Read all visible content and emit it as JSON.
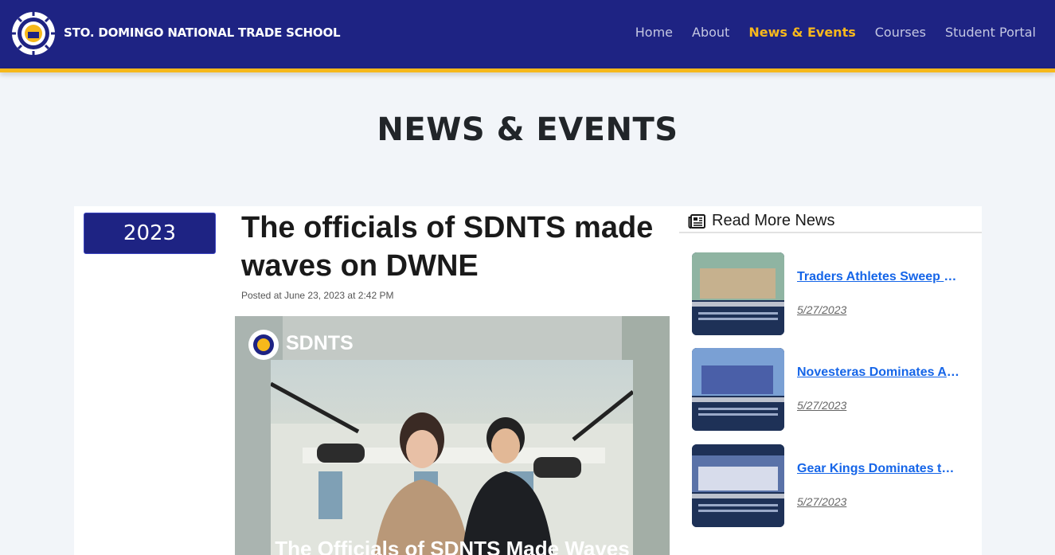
{
  "header": {
    "brand": "STO. DOMINGO NATIONAL TRADE SCHOOL",
    "nav": [
      {
        "label": "Home",
        "active": false
      },
      {
        "label": "About",
        "active": false
      },
      {
        "label": "News & Events",
        "active": true
      },
      {
        "label": "Courses",
        "active": false
      },
      {
        "label": "Student Portal",
        "active": false
      }
    ],
    "colors": {
      "bar": "#1e2383",
      "accent": "#f6b81b"
    }
  },
  "page_title": "NEWS & EVENTS",
  "article": {
    "year": "2023",
    "title": "The officials of SDNTS made waves on DWNE",
    "posted": "Posted at June 23, 2023 at 2:42 PM",
    "image": {
      "brand": "SDNTS",
      "caption": "The Officials of SDNTS Made Waves"
    }
  },
  "sidebar": {
    "heading": "Read More News",
    "items": [
      {
        "title": "Traders Athletes Sweep Medals in Impressive Fashion",
        "date": "5/27/2023"
      },
      {
        "title": "Novesteras Dominates Archery Continuously",
        "date": "5/27/2023"
      },
      {
        "title": "Gear Kings Dominates the Court",
        "date": "5/27/2023"
      }
    ]
  }
}
